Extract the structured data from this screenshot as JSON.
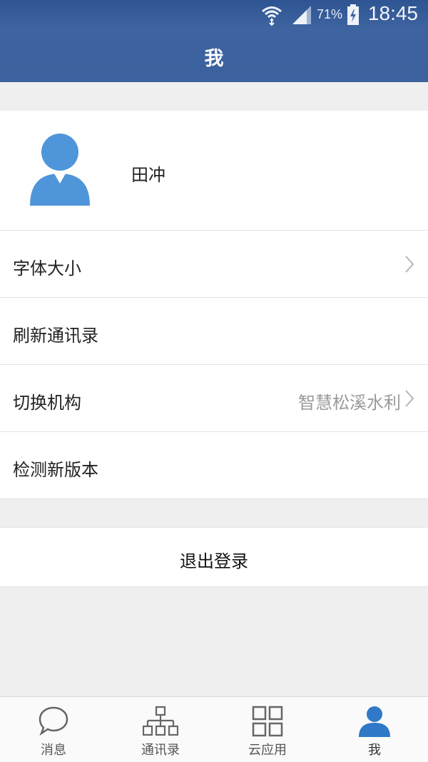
{
  "status_bar": {
    "battery_percent": "71%",
    "time": "18:45"
  },
  "header": {
    "title": "我"
  },
  "profile": {
    "name": "田冲"
  },
  "menu": {
    "items": [
      {
        "label": "字体大小",
        "value": "",
        "has_chevron": true
      },
      {
        "label": "刷新通讯录",
        "value": "",
        "has_chevron": false
      },
      {
        "label": "切换机构",
        "value": "智慧松溪水利",
        "has_chevron": true
      },
      {
        "label": "检测新版本",
        "value": "",
        "has_chevron": false
      }
    ]
  },
  "logout": {
    "label": "退出登录"
  },
  "tabbar": {
    "tabs": [
      {
        "label": "消息",
        "icon": "chat-bubble-icon"
      },
      {
        "label": "通讯录",
        "icon": "org-chart-icon"
      },
      {
        "label": "云应用",
        "icon": "grid-apps-icon"
      },
      {
        "label": "我",
        "icon": "person-icon"
      }
    ],
    "active_index": 3
  },
  "colors": {
    "header_blue": "#3c619e",
    "avatar_blue": "#4e96d9",
    "active_tab_blue": "#2f79c8",
    "background": "#efefef"
  }
}
